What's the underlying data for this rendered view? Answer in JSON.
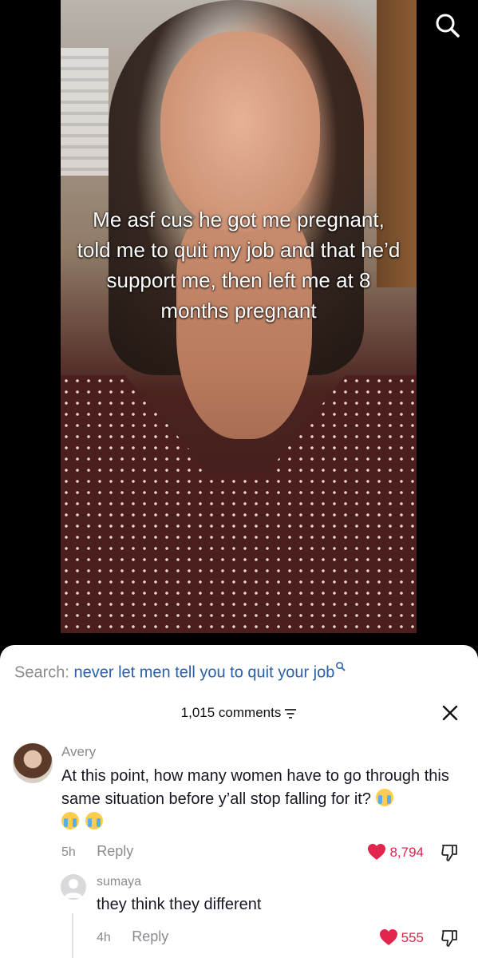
{
  "video": {
    "caption": "Me asf cus he got me pregnant, told me to quit my job and that he’d support me, then left me at 8 months pregnant"
  },
  "search": {
    "prefix": "Search:",
    "query": "never let men tell you to quit your job"
  },
  "comments_header": {
    "count_label": "1,015 comments"
  },
  "comments": [
    {
      "username": "Avery",
      "text": "At this point, how many women have to go through this same situation before y’all stop falling for it?",
      "time": "5h",
      "reply_label": "Reply",
      "likes": "8,794"
    }
  ],
  "replies": [
    {
      "username": "sumaya",
      "text": "they think they different",
      "time": "4h",
      "reply_label": "Reply",
      "likes": "555"
    }
  ],
  "colors": {
    "search_query": "#2a5fa8",
    "like_red": "#e1254d",
    "muted": "#8a8b91"
  }
}
